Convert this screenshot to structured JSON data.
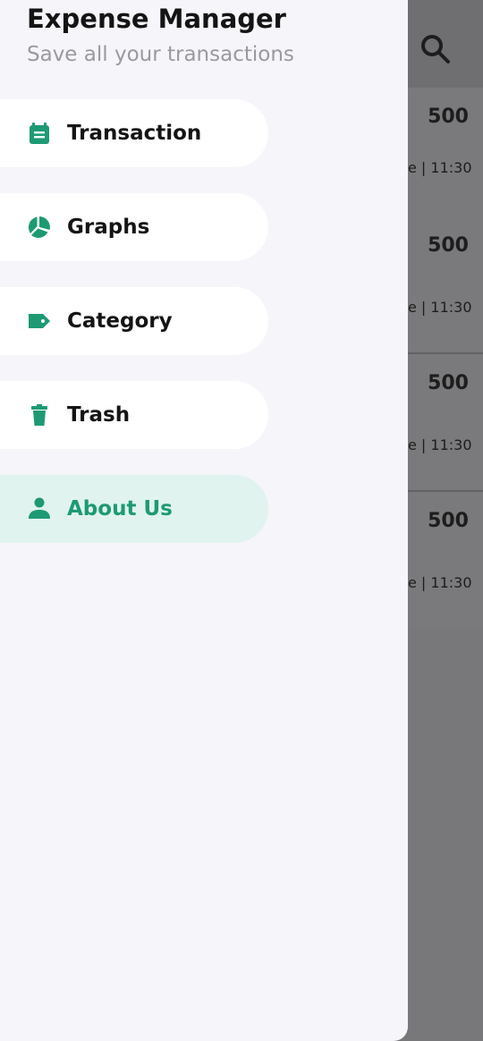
{
  "drawer": {
    "title": "Expense Manager",
    "subtitle": "Save all your transactions",
    "accent_color": "#1d9a73",
    "items": [
      {
        "label": "Transaction",
        "icon": "calendar-icon"
      },
      {
        "label": "Graphs",
        "icon": "pie-chart-icon"
      },
      {
        "label": "Category",
        "icon": "tag-icon"
      },
      {
        "label": "Trash",
        "icon": "trash-icon"
      },
      {
        "label": "About Us",
        "icon": "person-icon",
        "active": true
      }
    ]
  },
  "background": {
    "search_icon": "search-icon",
    "cards": [
      {
        "amount": "500",
        "time": "e | 11:30"
      },
      {
        "amount": "500",
        "time": "e | 11:30"
      },
      {
        "amount": "500",
        "time": "e | 11:30"
      },
      {
        "amount": "500",
        "time": "e | 11:30"
      }
    ]
  }
}
